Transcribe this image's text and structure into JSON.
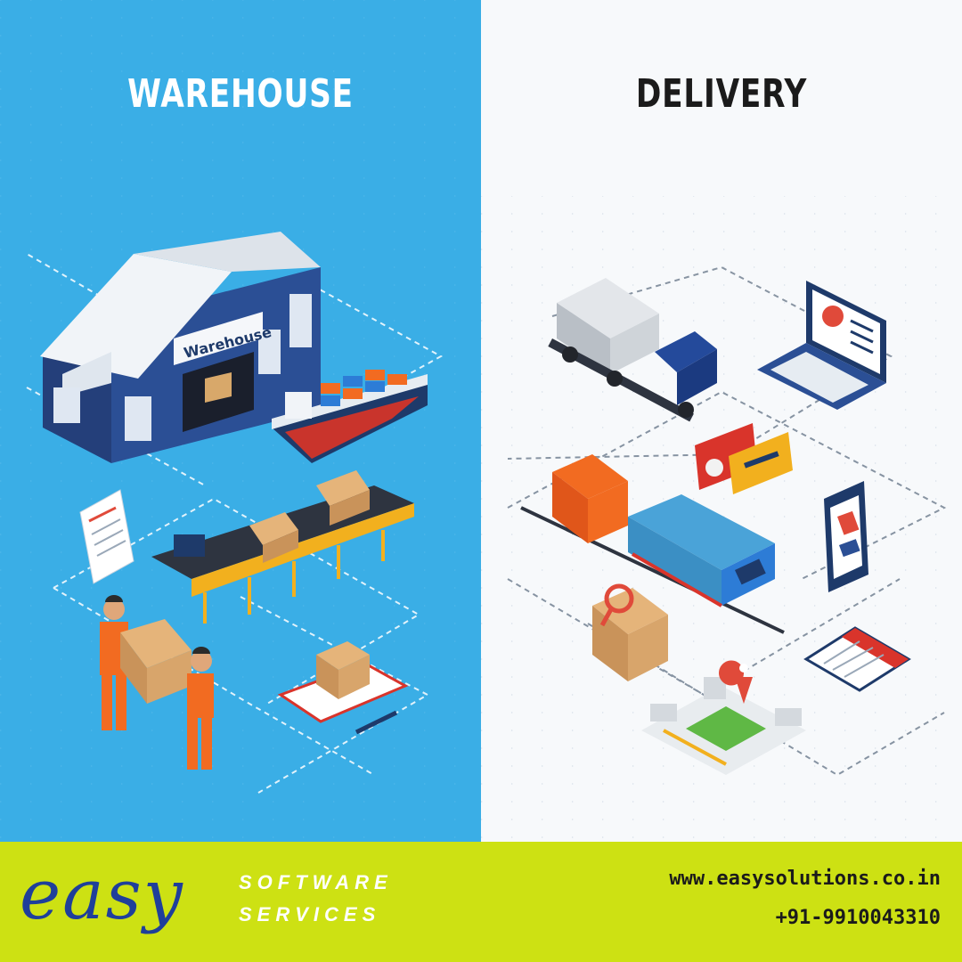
{
  "warehouse": {
    "heading": "WAREHOUSE",
    "building_sign": "Warehouse"
  },
  "delivery": {
    "heading": "DELIVERY"
  },
  "footer": {
    "brand_script": "easy",
    "brand_line1": "SOFTWARE",
    "brand_line2": "SERVICES",
    "website": "www.easysolutions.co.in",
    "phone": "+91-9910043310"
  },
  "colors": {
    "left_panel": "#3aaee6",
    "right_panel": "#f7f9fb",
    "footer": "#cde113",
    "brand_blue": "#1f3f9a",
    "accent_orange": "#f26b21",
    "navy": "#1e3a6a"
  }
}
